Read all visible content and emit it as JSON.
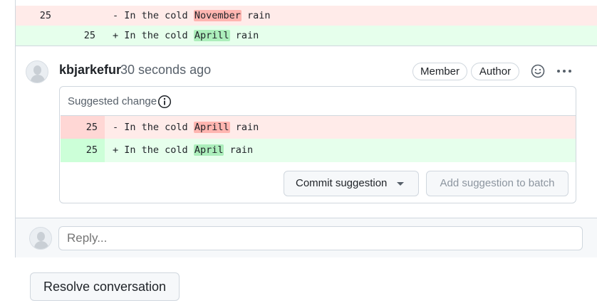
{
  "top_diff": {
    "removed": {
      "line_number": "25",
      "marker": "-",
      "prefix": "In the cold ",
      "highlight": "November",
      "suffix": " rain"
    },
    "added": {
      "line_number": "25",
      "marker": "+",
      "prefix": "In the cold ",
      "highlight": "Aprill",
      "suffix": " rain"
    }
  },
  "comment": {
    "author": "kbjarkefur",
    "timestamp": "30 seconds ago",
    "badges": [
      "Member",
      "Author"
    ],
    "icons": [
      "smiley-icon",
      "kebab-menu-icon"
    ]
  },
  "suggestion": {
    "title": "Suggested change",
    "removed": {
      "line_number": "25",
      "marker": "-",
      "prefix": "In the cold ",
      "highlight": "Aprill",
      "suffix": " rain"
    },
    "added": {
      "line_number": "25",
      "marker": "+",
      "prefix": "In the cold ",
      "highlight": "April",
      "suffix": " rain"
    },
    "commit_label": "Commit suggestion",
    "batch_label": "Add suggestion to batch"
  },
  "reply": {
    "placeholder": "Reply..."
  },
  "resolve_label": "Resolve conversation",
  "colors": {
    "deletion_bg": "#ffebe9",
    "addition_bg": "#e6ffec",
    "deletion_highlight": "#ffb5b0",
    "addition_highlight": "#aceebb",
    "border": "#d0d7de"
  }
}
